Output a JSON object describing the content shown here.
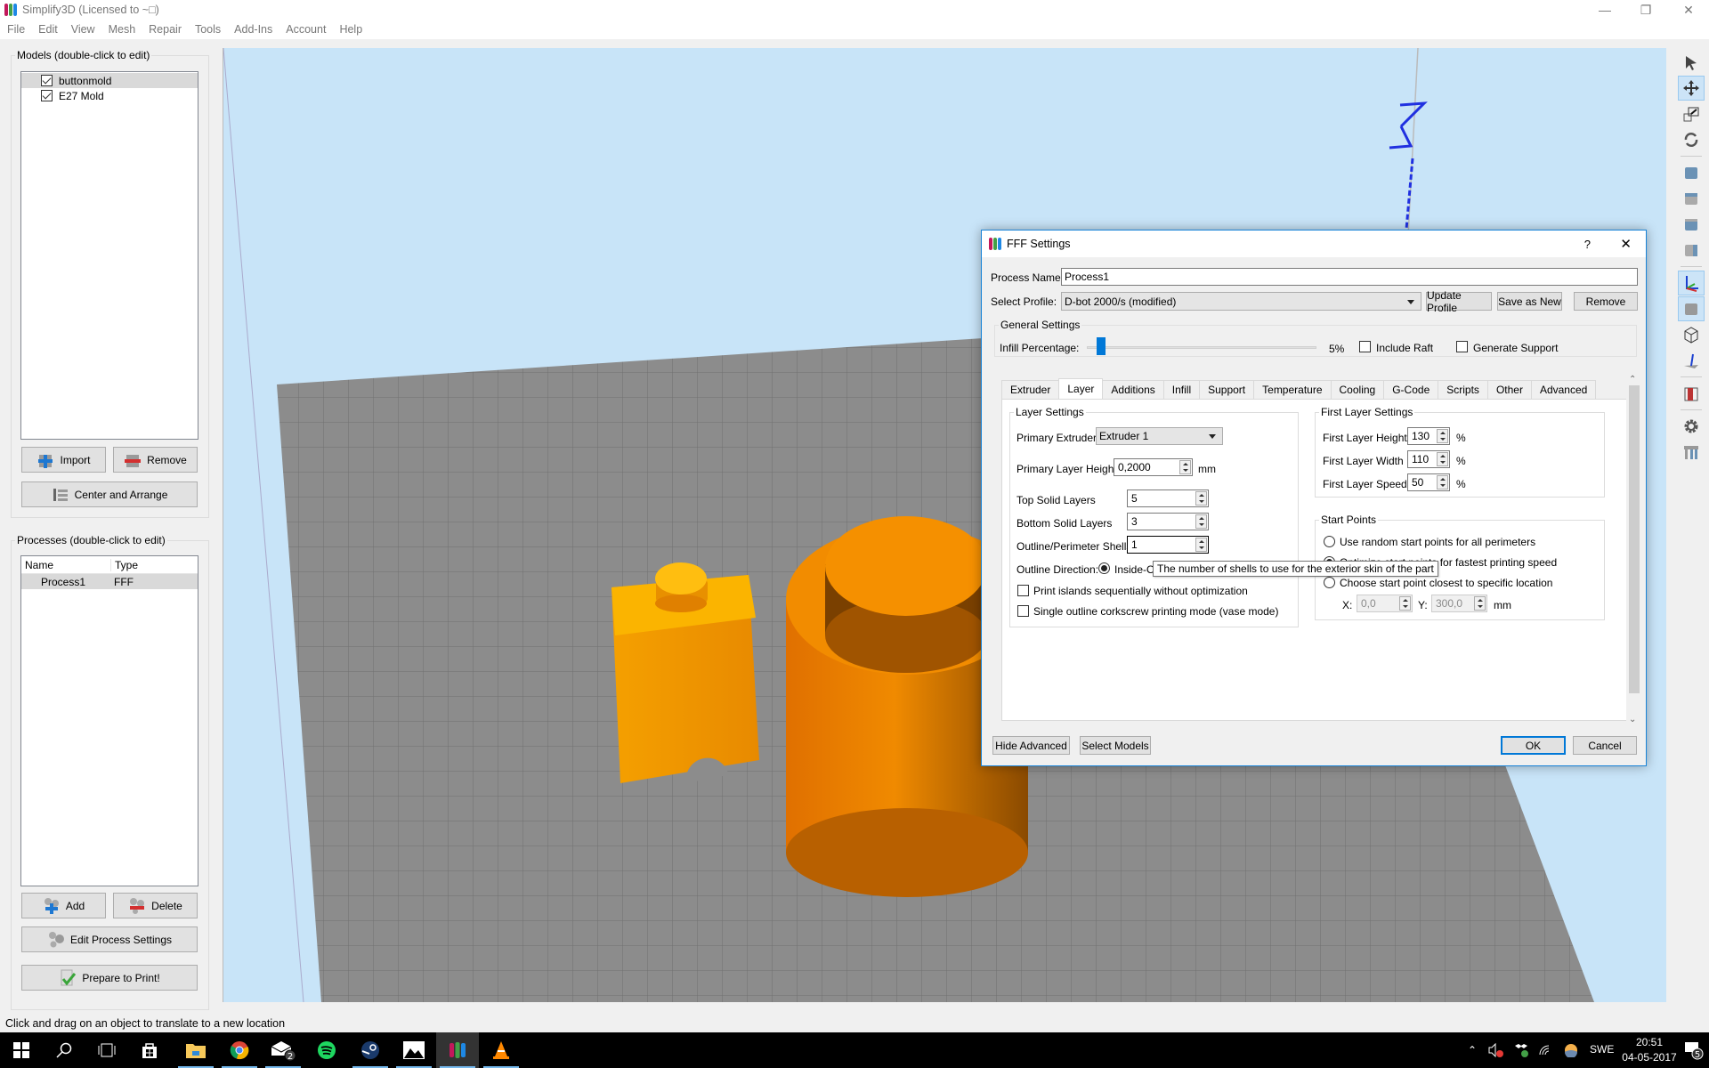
{
  "app": {
    "title": "Simplify3D (Licensed to ~□)",
    "window_controls": {
      "minimize": "—",
      "restore": "❐",
      "close": "✕"
    }
  },
  "menu": [
    "File",
    "Edit",
    "View",
    "Mesh",
    "Repair",
    "Tools",
    "Add-Ins",
    "Account",
    "Help"
  ],
  "models": {
    "title": "Models (double-click to edit)",
    "items": [
      {
        "name": "buttonmold",
        "checked": true,
        "selected": true
      },
      {
        "name": "E27 Mold",
        "checked": true,
        "selected": false
      }
    ],
    "import_label": "Import",
    "remove_label": "Remove",
    "center_label": "Center and Arrange"
  },
  "processes": {
    "title": "Processes (double-click to edit)",
    "columns": [
      "Name",
      "Type"
    ],
    "rows": [
      {
        "name": "Process1",
        "type": "FFF"
      }
    ],
    "add_label": "Add",
    "delete_label": "Delete",
    "edit_label": "Edit Process Settings",
    "prepare_label": "Prepare to Print!"
  },
  "status_text": "Click and drag on an object to translate to a new location",
  "right_toolbar": [
    "select-arrow",
    "move",
    "scale",
    "rotate",
    "view-iso",
    "view-top",
    "view-front",
    "view-side",
    "axes",
    "solid",
    "wireframe",
    "build-direction",
    "cross-section",
    "settings",
    "supports"
  ],
  "dialog": {
    "title": "FFF Settings",
    "help": "?",
    "close": "✕",
    "process_name_label": "Process Name:",
    "process_name_value": "Process1",
    "select_profile_label": "Select Profile:",
    "select_profile_value": "D-bot 2000/s (modified)",
    "update_profile": "Update Profile",
    "save_as_new": "Save as New",
    "remove": "Remove",
    "general_settings": "General Settings",
    "infill_label": "Infill Percentage:",
    "infill_value": "5%",
    "infill_fraction": 0.05,
    "include_raft": "Include Raft",
    "include_raft_checked": false,
    "generate_support": "Generate Support",
    "generate_support_checked": false,
    "tabs": [
      "Extruder",
      "Layer",
      "Additions",
      "Infill",
      "Support",
      "Temperature",
      "Cooling",
      "G-Code",
      "Scripts",
      "Other",
      "Advanced"
    ],
    "active_tab": "Layer",
    "layer_settings": {
      "title": "Layer Settings",
      "primary_extruder_label": "Primary Extruder",
      "primary_extruder_value": "Extruder 1",
      "primary_layer_height_label": "Primary Layer Height",
      "primary_layer_height_value": "0,2000",
      "primary_layer_height_unit": "mm",
      "top_solid_label": "Top Solid Layers",
      "top_solid_value": "5",
      "bottom_solid_label": "Bottom Solid Layers",
      "bottom_solid_value": "3",
      "shells_label": "Outline/Perimeter Shells",
      "shells_value": "1",
      "outline_dir_label": "Outline Direction:",
      "outline_dir_value": "Inside-Out",
      "islands_label": "Print islands sequentially without optimization",
      "islands_checked": false,
      "vase_label": "Single outline corkscrew printing mode (vase mode)",
      "vase_checked": false
    },
    "first_layer": {
      "title": "First Layer Settings",
      "height_label": "First Layer Height",
      "height_value": "130",
      "width_label": "First Layer Width",
      "width_value": "110",
      "speed_label": "First Layer Speed",
      "speed_value": "50",
      "unit": "%"
    },
    "start_points": {
      "title": "Start Points",
      "random_label": "Use random start points for all perimeters",
      "optimize_label": "Optimize start points for fastest printing speed",
      "specific_label": "Choose start point closest to specific location",
      "selected": "optimize",
      "x_label": "X:",
      "x_value": "0,0",
      "y_label": "Y:",
      "y_value": "300,0",
      "unit": "mm"
    },
    "tooltip": "The number of shells to use for the exterior skin of the part",
    "hide_advanced": "Hide Advanced",
    "select_models": "Select Models",
    "ok": "OK",
    "cancel": "Cancel"
  },
  "taskbar": {
    "apps": [
      "start",
      "search",
      "task-view",
      "store",
      "file-explorer",
      "chrome",
      "mail",
      "spotify",
      "steam",
      "photos",
      "simplify3d",
      "vlc"
    ],
    "mail_badge": "2",
    "tray": {
      "language": "SWE",
      "time": "20:51",
      "date": "04-05-2017",
      "notifications": "5"
    }
  },
  "colors": {
    "accent": "#0078d7",
    "model": "#f08a00",
    "bed": "#8c8c8c",
    "sky": "#c8e4f8"
  }
}
